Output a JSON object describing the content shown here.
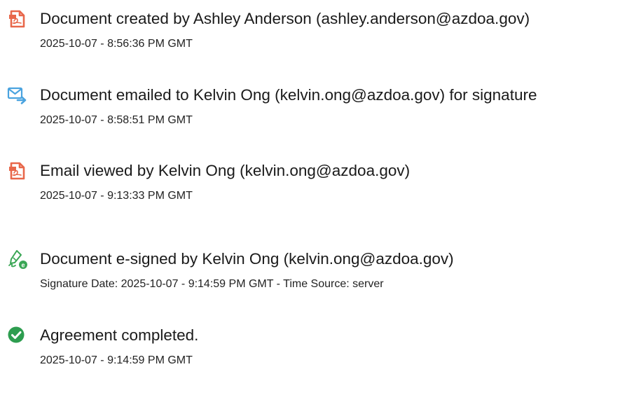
{
  "events": [
    {
      "icon": "document-created-icon",
      "title": "Document created by Ashley Anderson (ashley.anderson@azdoa.gov)",
      "detail": "2025-10-07 - 8:56:36 PM GMT"
    },
    {
      "icon": "email-sent-icon",
      "title": "Document emailed to Kelvin Ong (kelvin.ong@azdoa.gov) for signature",
      "detail": "2025-10-07 - 8:58:51 PM GMT"
    },
    {
      "icon": "email-viewed-icon",
      "title": "Email viewed by Kelvin Ong (kelvin.ong@azdoa.gov)",
      "detail": "2025-10-07 - 9:13:33 PM GMT"
    },
    {
      "icon": "e-signed-icon",
      "title": "Document e-signed by Kelvin Ong (kelvin.ong@azdoa.gov)",
      "detail": "Signature Date: 2025-10-07 - 9:14:59 PM GMT - Time Source: server"
    },
    {
      "icon": "agreement-completed-icon",
      "title": "Agreement completed.",
      "detail": "2025-10-07 - 9:14:59 PM GMT"
    }
  ],
  "colors": {
    "acrobat_orange": "#e8674a",
    "email_blue": "#4aa3df",
    "sign_green": "#3aa655",
    "check_green": "#2d9d4f"
  }
}
